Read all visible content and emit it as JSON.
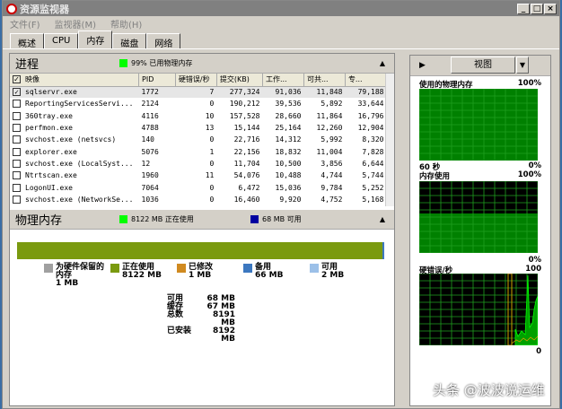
{
  "window": {
    "title": "资源监视器",
    "buttons": [
      "_",
      "□",
      "×"
    ]
  },
  "menu": [
    "文件(F)",
    "监视器(M)",
    "帮助(H)"
  ],
  "tabs": [
    "概述",
    "CPU",
    "内存",
    "磁盘",
    "网络"
  ],
  "active_tab": "内存",
  "processes": {
    "title": "进程",
    "legend": "99% 已用物理内存",
    "legend_color": "#00ff00",
    "columns": [
      "映像",
      "PID",
      "硬错误/秒",
      "提交(KB)",
      "工作...",
      "可共...",
      "专..."
    ],
    "rows": [
      [
        "sqlservr.exe",
        "1772",
        "7",
        "277,324",
        "91,036",
        "11,848",
        "79,188"
      ],
      [
        "ReportingServicesServi...",
        "2124",
        "0",
        "190,212",
        "39,536",
        "5,892",
        "33,644"
      ],
      [
        "360tray.exe",
        "4116",
        "10",
        "157,528",
        "28,660",
        "11,864",
        "16,796"
      ],
      [
        "perfmon.exe",
        "4788",
        "13",
        "15,144",
        "25,164",
        "12,260",
        "12,904"
      ],
      [
        "svchost.exe (netsvcs)",
        "140",
        "0",
        "22,716",
        "14,312",
        "5,992",
        "8,320"
      ],
      [
        "explorer.exe",
        "5076",
        "1",
        "22,156",
        "18,832",
        "11,004",
        "7,828"
      ],
      [
        "svchost.exe (LocalSyst...",
        "12",
        "0",
        "11,704",
        "10,500",
        "3,856",
        "6,644"
      ],
      [
        "Ntrtscan.exe",
        "1960",
        "11",
        "54,076",
        "10,488",
        "4,744",
        "5,744"
      ],
      [
        "LogonUI.exe",
        "7064",
        "0",
        "6,472",
        "15,036",
        "9,784",
        "5,252"
      ],
      [
        "svchost.exe (NetworkSe...",
        "1036",
        "0",
        "16,460",
        "9,920",
        "4,752",
        "5,168"
      ]
    ],
    "checked": [
      true,
      false,
      false,
      false,
      false,
      false,
      false,
      false,
      false,
      false
    ]
  },
  "physical_memory": {
    "title": "物理内存",
    "legend_in_use": "8122 MB 正在使用",
    "legend_available": "68 MB 可用",
    "in_use_fraction": 0.991,
    "categories": [
      {
        "label": "为硬件保留的内存",
        "value": "1 MB",
        "color": "#a0a0a0"
      },
      {
        "label": "正在使用",
        "value": "8122 MB",
        "color": "#7a9a0f"
      },
      {
        "label": "已修改",
        "value": "1 MB",
        "color": "#d08a20"
      },
      {
        "label": "备用",
        "value": "66 MB",
        "color": "#3c78c0"
      },
      {
        "label": "可用",
        "value": "2 MB",
        "color": "#9cc0e8"
      }
    ],
    "summary": [
      [
        "可用",
        "68 MB"
      ],
      [
        "缓存",
        "67 MB"
      ],
      [
        "总数",
        "8191 MB"
      ],
      [
        "已安装",
        "8192 MB"
      ]
    ]
  },
  "graphs": {
    "view_label": "视图",
    "items": [
      {
        "title": "使用的物理内存",
        "max": "100%",
        "min": "0%",
        "time": "60 秒",
        "level": 1.0
      },
      {
        "title": "内存使用",
        "max": "100%",
        "min": "0%",
        "level": 0.55
      },
      {
        "title": "硬错误/秒",
        "max": "100",
        "min": "0"
      }
    ]
  },
  "watermark": "头条 @波波说运维"
}
